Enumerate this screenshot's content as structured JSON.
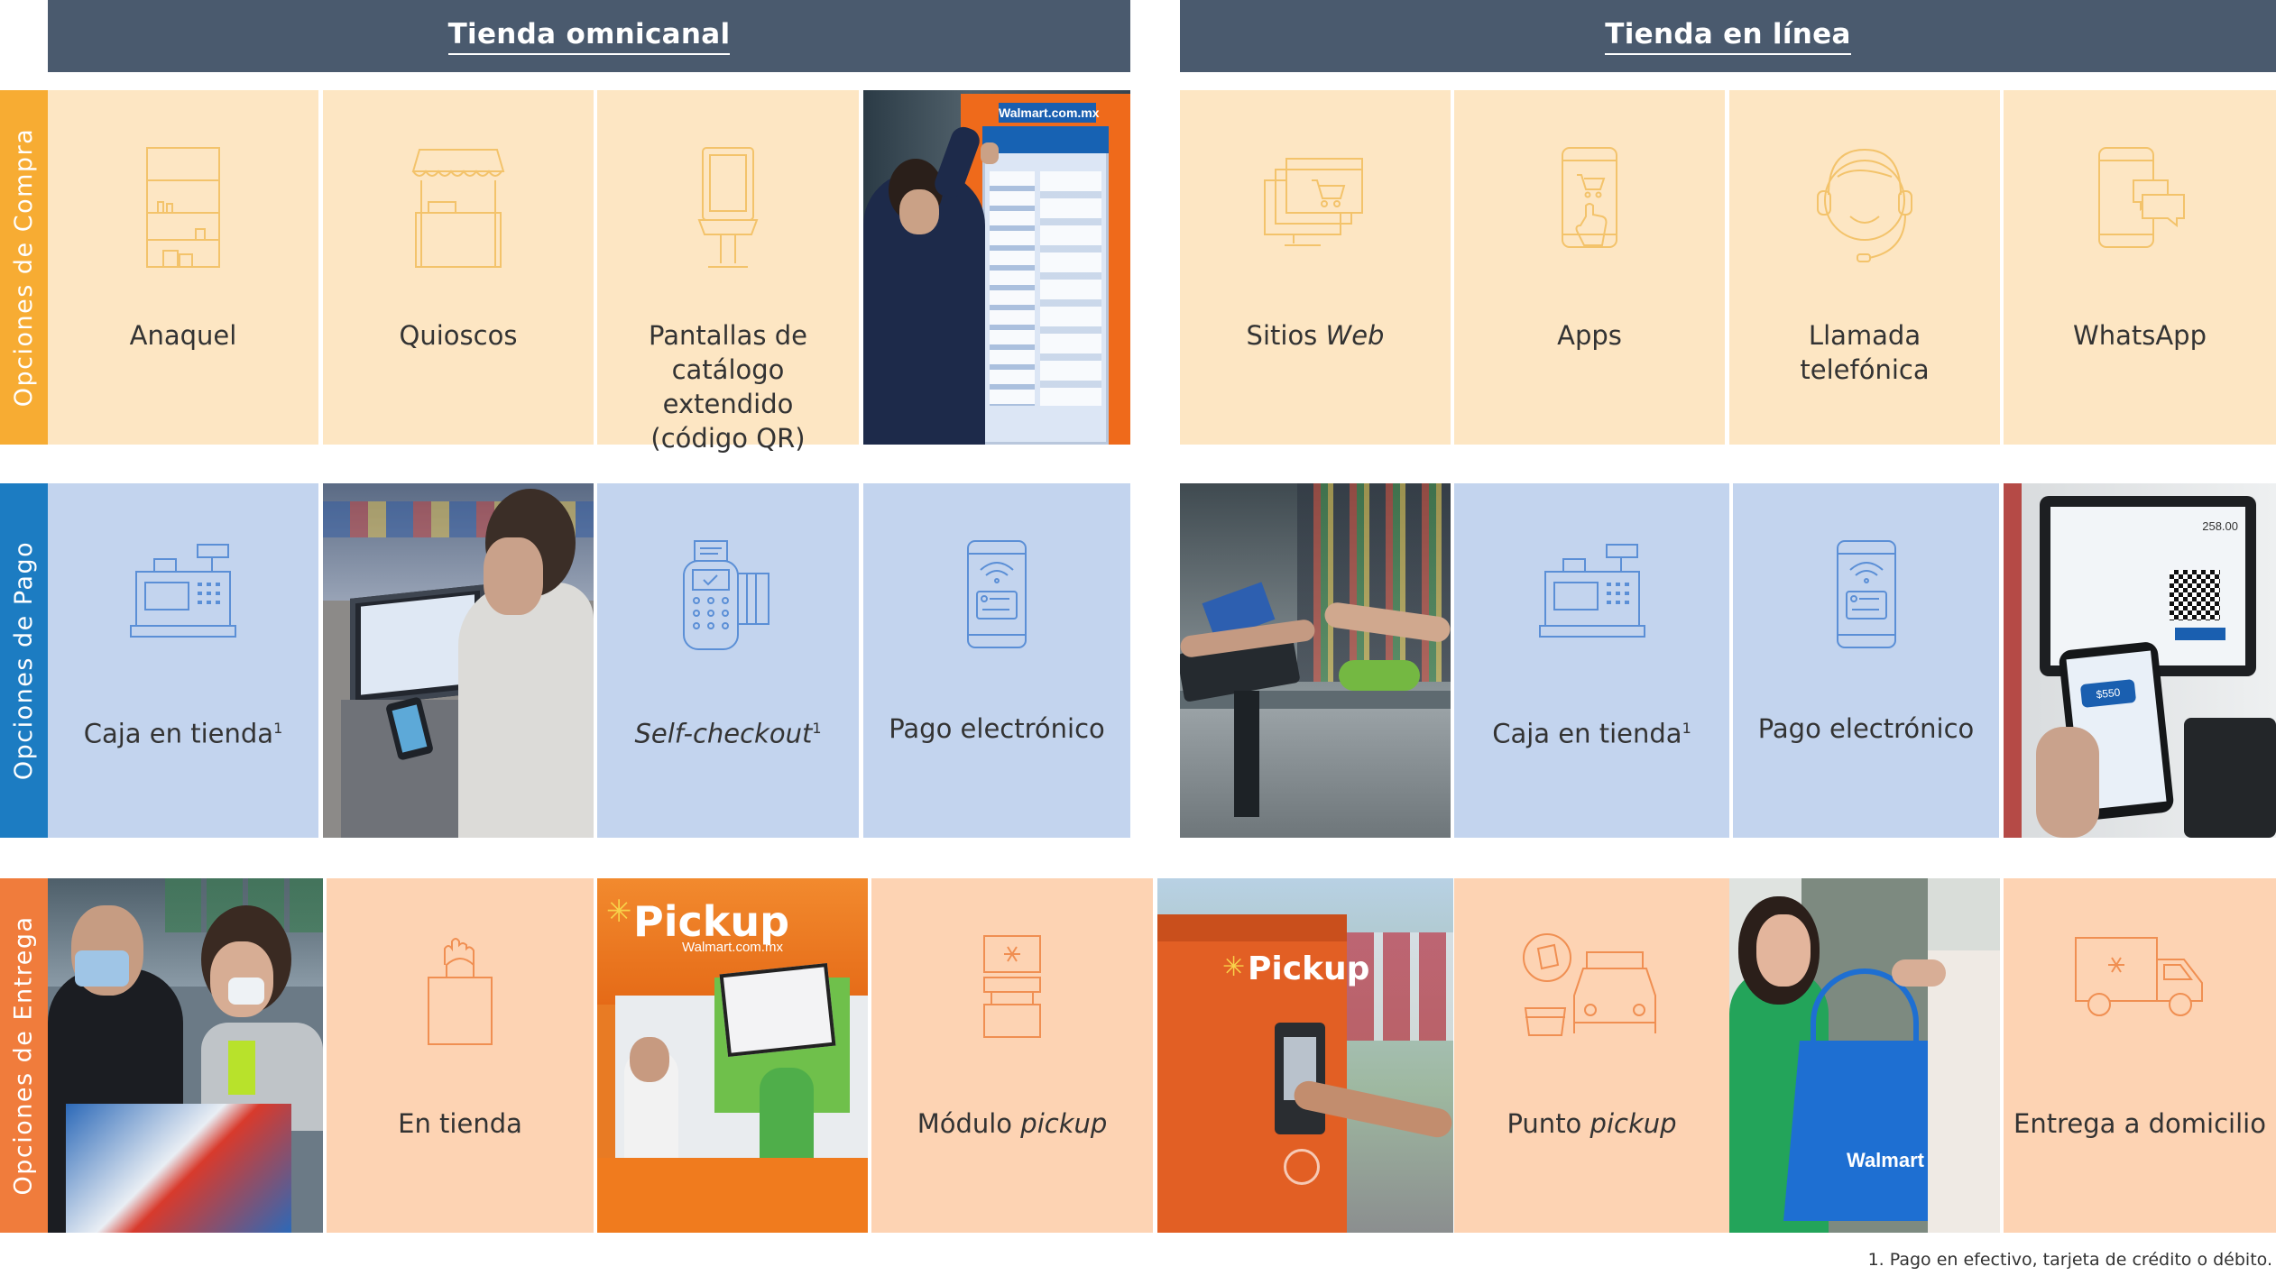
{
  "headers": {
    "omnichannel": "Tienda omnicanal",
    "online": "Tienda en línea"
  },
  "rows": {
    "purchase": "Opciones de Compra",
    "payment": "Opciones de Pago",
    "delivery": "Opciones de Entrega"
  },
  "purchase": {
    "shelf": "Anaquel",
    "kiosks": "Quioscos",
    "catalog_screens": [
      "Pantallas de",
      "catálogo extendido",
      "(código QR)"
    ],
    "websites_pre": "Sitios ",
    "websites_em": "Web",
    "apps": "Apps",
    "phone_call": [
      "Llamada",
      "telefónica"
    ],
    "whatsapp": "WhatsApp",
    "kiosk_screen_brand": "Walmart.com.mx"
  },
  "payment": {
    "in_store_cash": "Caja en tienda",
    "in_store_cash_sup": "1",
    "self_checkout": "Self-checkout",
    "self_checkout_sup": "1",
    "electronic": "Pago electrónico",
    "online_in_store_cash": "Caja en tienda",
    "online_in_store_cash_sup": "1",
    "online_electronic": "Pago electrónico",
    "phone_amount": "$550",
    "terminal_total": "258.00"
  },
  "delivery": {
    "in_store": "En tienda",
    "module_pre": "Módulo ",
    "module_em": "pickup",
    "point_pre": "Punto ",
    "point_em": "pickup",
    "home": "Entrega a domicilio",
    "pickup_sign": "Pickup",
    "pickup_sign_sub": "Walmart.com.mx",
    "pickup_locker": "Pickup",
    "bag_brand": "Walmart"
  },
  "footnote": "1. Pago en efectivo, tarjeta de crédito o débito.",
  "colors": {
    "header": "#4a5a6e",
    "purchase_bar": "#f7ac33",
    "payment_bar": "#1c7cc2",
    "delivery_bar": "#f07c3c",
    "purchase_tile": "#fde6c3",
    "payment_tile": "#c3d4ee",
    "delivery_tile": "#fdd3b3"
  }
}
